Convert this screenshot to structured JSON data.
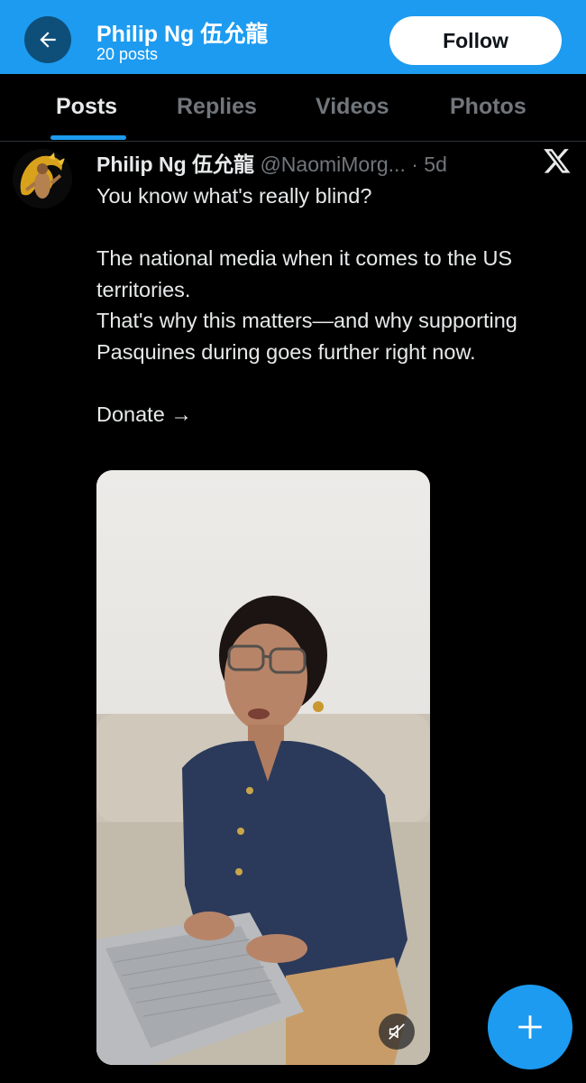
{
  "header": {
    "name": "Philip Ng 伍允龍",
    "post_count": "20 posts",
    "follow_label": "Follow"
  },
  "tabs": [
    {
      "label": "Posts",
      "active": true
    },
    {
      "label": "Replies",
      "active": false
    },
    {
      "label": "Videos",
      "active": false
    },
    {
      "label": "Photos",
      "active": false
    }
  ],
  "post": {
    "author_name": "Philip Ng 伍允龍",
    "meta": "@NaomiMorg... · 5d",
    "text": "You know what's really blind?\n\nThe national media when it comes to the US territories.\nThat's why this matters—and why supporting Pasquines during  goes further right now.\n\nDonate →"
  },
  "colors": {
    "accent": "#1d9bf0",
    "background": "#000000",
    "muted_text": "#71767b"
  },
  "icons": {
    "back": "arrow-left-icon",
    "platform": "x-logo-icon",
    "mute": "speaker-muted-icon",
    "compose": "plus-icon"
  }
}
